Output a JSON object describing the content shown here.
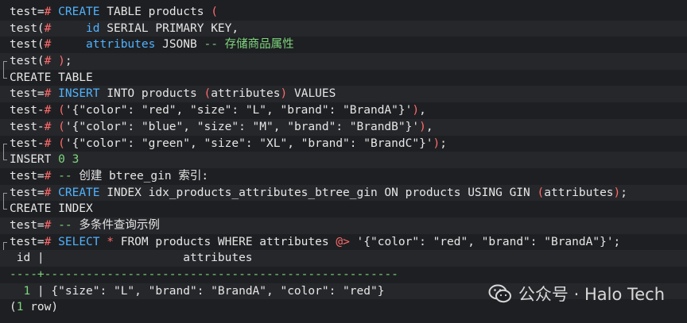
{
  "lines": [
    {
      "gutter": "",
      "segs": [
        {
          "c": "prompt",
          "t": "test="
        },
        {
          "c": "op",
          "t": "#"
        },
        {
          "c": "txt",
          "t": " "
        },
        {
          "c": "kw",
          "t": "CREATE"
        },
        {
          "c": "txt",
          "t": " TABLE products "
        },
        {
          "c": "op",
          "t": "("
        }
      ]
    },
    {
      "gutter": "",
      "segs": [
        {
          "c": "prompt",
          "t": "test("
        },
        {
          "c": "op",
          "t": "#"
        },
        {
          "c": "txt",
          "t": "     "
        },
        {
          "c": "kw",
          "t": "id"
        },
        {
          "c": "txt",
          "t": " SERIAL PRIMARY KEY,"
        }
      ]
    },
    {
      "gutter": "",
      "segs": [
        {
          "c": "prompt",
          "t": "test("
        },
        {
          "c": "op",
          "t": "#"
        },
        {
          "c": "txt",
          "t": "     "
        },
        {
          "c": "kw",
          "t": "attributes"
        },
        {
          "c": "txt",
          "t": " JSONB "
        },
        {
          "c": "cm",
          "t": "-- 存储商品属性"
        }
      ]
    },
    {
      "gutter": "start",
      "segs": [
        {
          "c": "prompt",
          "t": "test("
        },
        {
          "c": "op",
          "t": "#"
        },
        {
          "c": "txt",
          "t": " "
        },
        {
          "c": "op",
          "t": ")"
        },
        {
          "c": "txt",
          "t": ";"
        }
      ]
    },
    {
      "gutter": "end",
      "segs": [
        {
          "c": "plain",
          "t": "CREATE TABLE"
        }
      ]
    },
    {
      "gutter": "",
      "segs": [
        {
          "c": "prompt",
          "t": "test="
        },
        {
          "c": "op",
          "t": "#"
        },
        {
          "c": "txt",
          "t": " "
        },
        {
          "c": "kw",
          "t": "INSERT"
        },
        {
          "c": "txt",
          "t": " INTO products "
        },
        {
          "c": "op",
          "t": "("
        },
        {
          "c": "txt",
          "t": "attributes"
        },
        {
          "c": "op",
          "t": ")"
        },
        {
          "c": "txt",
          "t": " VALUES"
        }
      ]
    },
    {
      "gutter": "",
      "segs": [
        {
          "c": "prompt",
          "t": "test-"
        },
        {
          "c": "op",
          "t": "#"
        },
        {
          "c": "txt",
          "t": " "
        },
        {
          "c": "op",
          "t": "("
        },
        {
          "c": "str",
          "t": "'{\"color\": \"red\", \"size\": \"L\", \"brand\": \"BrandA\"}'"
        },
        {
          "c": "op",
          "t": ")"
        },
        {
          "c": "txt",
          "t": ","
        }
      ]
    },
    {
      "gutter": "",
      "segs": [
        {
          "c": "prompt",
          "t": "test-"
        },
        {
          "c": "op",
          "t": "#"
        },
        {
          "c": "txt",
          "t": " "
        },
        {
          "c": "op",
          "t": "("
        },
        {
          "c": "str",
          "t": "'{\"color\": \"blue\", \"size\": \"M\", \"brand\": \"BrandB\"}'"
        },
        {
          "c": "op",
          "t": ")"
        },
        {
          "c": "txt",
          "t": ","
        }
      ]
    },
    {
      "gutter": "start",
      "segs": [
        {
          "c": "prompt",
          "t": "test-"
        },
        {
          "c": "op",
          "t": "#"
        },
        {
          "c": "txt",
          "t": " "
        },
        {
          "c": "op",
          "t": "("
        },
        {
          "c": "str",
          "t": "'{\"color\": \"green\", \"size\": \"XL\", \"brand\": \"BrandC\"}'"
        },
        {
          "c": "op",
          "t": ")"
        },
        {
          "c": "txt",
          "t": ";"
        }
      ]
    },
    {
      "gutter": "end",
      "segs": [
        {
          "c": "plain",
          "t": "INSERT "
        },
        {
          "c": "num",
          "t": "0 3"
        }
      ]
    },
    {
      "gutter": "",
      "segs": [
        {
          "c": "prompt",
          "t": "test="
        },
        {
          "c": "op",
          "t": "#"
        },
        {
          "c": "txt",
          "t": " "
        },
        {
          "c": "cm",
          "t": "--"
        },
        {
          "c": "txt",
          "t": " 创建 btree_gin 索引:"
        }
      ]
    },
    {
      "gutter": "start",
      "segs": [
        {
          "c": "prompt",
          "t": "test="
        },
        {
          "c": "op",
          "t": "#"
        },
        {
          "c": "txt",
          "t": " "
        },
        {
          "c": "kw",
          "t": "CREATE"
        },
        {
          "c": "txt",
          "t": " INDEX idx_products_attributes_btree_gin ON products USING GIN "
        },
        {
          "c": "op",
          "t": "("
        },
        {
          "c": "txt",
          "t": "attributes"
        },
        {
          "c": "op",
          "t": ")"
        },
        {
          "c": "txt",
          "t": ";"
        }
      ]
    },
    {
      "gutter": "end",
      "segs": [
        {
          "c": "plain",
          "t": "CREATE INDEX"
        }
      ]
    },
    {
      "gutter": "",
      "segs": [
        {
          "c": "prompt",
          "t": "test="
        },
        {
          "c": "op",
          "t": "#"
        },
        {
          "c": "txt",
          "t": " "
        },
        {
          "c": "cm",
          "t": "--"
        },
        {
          "c": "txt",
          "t": " 多条件查询示例"
        }
      ]
    },
    {
      "gutter": "start",
      "segs": [
        {
          "c": "prompt",
          "t": "test="
        },
        {
          "c": "op",
          "t": "#"
        },
        {
          "c": "txt",
          "t": " "
        },
        {
          "c": "kw",
          "t": "SELECT"
        },
        {
          "c": "txt",
          "t": " "
        },
        {
          "c": "op",
          "t": "*"
        },
        {
          "c": "txt",
          "t": " FROM products WHERE attributes "
        },
        {
          "c": "op",
          "t": "@>"
        },
        {
          "c": "txt",
          "t": " '{\"color\": \"red\", \"brand\": \"BrandA\"}';"
        }
      ]
    },
    {
      "gutter": "",
      "segs": [
        {
          "c": "plain",
          "t": " id |                    attributes"
        }
      ]
    },
    {
      "gutter": "",
      "segs": [
        {
          "c": "dash",
          "t": "----+---------------------------------------------------"
        }
      ]
    },
    {
      "gutter": "",
      "segs": [
        {
          "c": "plain",
          "t": "  "
        },
        {
          "c": "num",
          "t": "1"
        },
        {
          "c": "plain",
          "t": " | {\"size\": \"L\", \"brand\": \"BrandA\", \"color\": \"red\"}"
        }
      ]
    },
    {
      "gutter": "",
      "segs": [
        {
          "c": "plain",
          "t": "("
        },
        {
          "c": "num",
          "t": "1"
        },
        {
          "c": "plain",
          "t": " row)"
        }
      ]
    }
  ],
  "watermark": {
    "text": "公众号 · Halo Tech",
    "icon": "wechat-icon"
  }
}
